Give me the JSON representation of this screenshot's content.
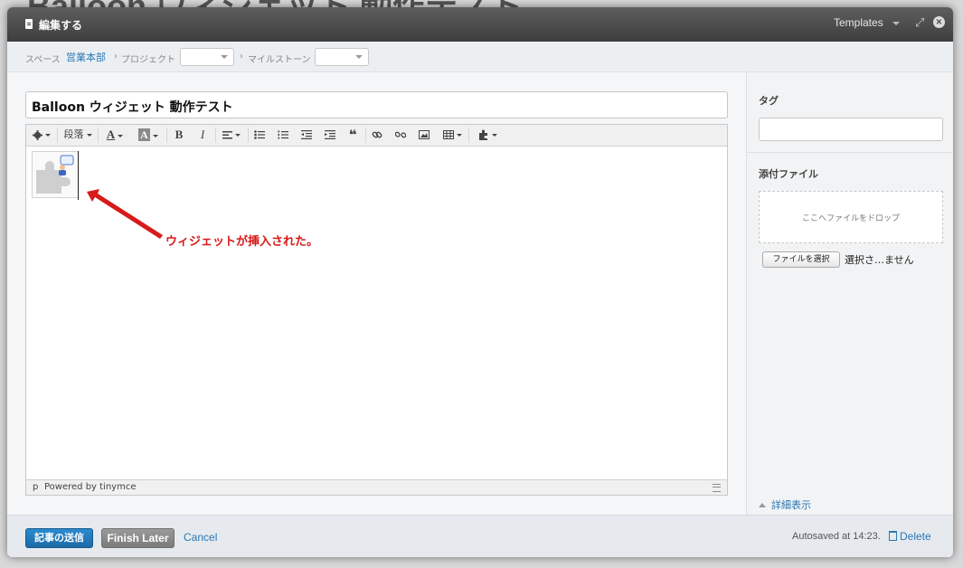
{
  "background": {
    "title": "Balloon ウィジェット 動作テスト"
  },
  "modal": {
    "title": "編集する",
    "templates_label": "Templates",
    "expand_icon": "expand-icon",
    "close_icon": "close-icon"
  },
  "breadcrumb": {
    "space_label": "スペース",
    "space_value": "営業本部",
    "project_label": "プロジェクト",
    "project_value": "",
    "milestone_label": "マイルストーン",
    "milestone_value": ""
  },
  "editor": {
    "title_value": "Balloon ウィジェット 動作テスト",
    "toolbar": {
      "format_label": "段落",
      "bold": "B",
      "italic": "I",
      "font_color": "A",
      "bg_color": "A"
    },
    "status_path": "p",
    "powered_by": "Powered by tinymce"
  },
  "annotation": {
    "text": "ウィジェットが挿入された。",
    "color": "#d71a1a"
  },
  "sidebar": {
    "tag_label": "タグ",
    "tag_value": "",
    "attach_label": "添付ファイル",
    "dropzone_text": "ここへファイルをドロップ",
    "file_button": "ファイルを選択",
    "file_status": "選択さ…ません",
    "detail_link": "詳細表示"
  },
  "footer": {
    "submit_label": "記事の送信",
    "finish_later_label": "Finish Later",
    "cancel_label": "Cancel",
    "autosave_text": "Autosaved at 14:23.",
    "delete_label": "Delete"
  },
  "colors": {
    "accent": "#2a78b5",
    "submit_bg": "#1f74b8",
    "titlebar": "#4a4a4a"
  }
}
